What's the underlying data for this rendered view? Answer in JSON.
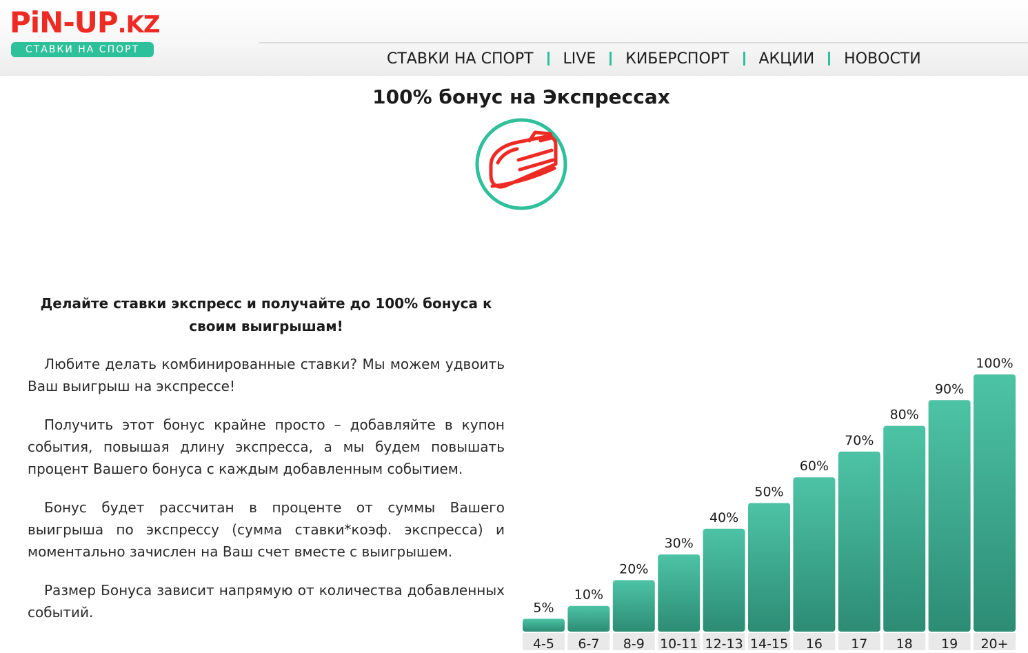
{
  "header": {
    "logo": {
      "brand": "PiN-UP",
      "domain": ".KZ",
      "tagline": "СТАВКИ НА СПОРТ"
    },
    "nav": [
      "СТАВКИ НА СПОРТ",
      "LIVE",
      "КИБЕРСПОРТ",
      "АКЦИИ",
      "НОВОСТИ"
    ]
  },
  "promo": {
    "title": "100% бонус на Экспрессах",
    "icon": "express-train-icon"
  },
  "content": {
    "lead": "Делайте ставки экспресс и получайте до 100% бонуса к своим выигрышам!",
    "paragraphs": [
      "Любите делать комбинированные ставки? Мы можем удвоить Ваш выигрыш на экспрессе!",
      "Получить этот бонус крайне просто – добавляйте в купон события, повышая длину экспресса, а мы будем повышать процент Вашего бонуса с каждым добавленным событием.",
      "Бонус будет рассчитан в проценте от суммы Вашего выигрыша по экспрессу (сумма ставки*коэф. экспресса) и моментально зачислен на Ваш счет вместе с выигрышем.",
      "Размер Бонуса зависит напрямую от количества добавленных событий."
    ]
  },
  "colors": {
    "accent": "#2ec09b",
    "brand": "#ee2a24",
    "bar_top": "#4dc3a5",
    "bar_bottom": "#2c8c74"
  },
  "chart_data": {
    "type": "bar",
    "categories": [
      "4-5",
      "6-7",
      "8-9",
      "10-11",
      "12-13",
      "14-15",
      "16",
      "17",
      "18",
      "19",
      "20+"
    ],
    "values": [
      5,
      10,
      20,
      30,
      40,
      50,
      60,
      70,
      80,
      90,
      100
    ],
    "data_labels": [
      "5%",
      "10%",
      "20%",
      "30%",
      "40%",
      "50%",
      "60%",
      "70%",
      "80%",
      "90%",
      "100%"
    ],
    "title": "",
    "xlabel": "",
    "ylabel": "",
    "ylim": [
      0,
      100
    ],
    "grid": false
  }
}
